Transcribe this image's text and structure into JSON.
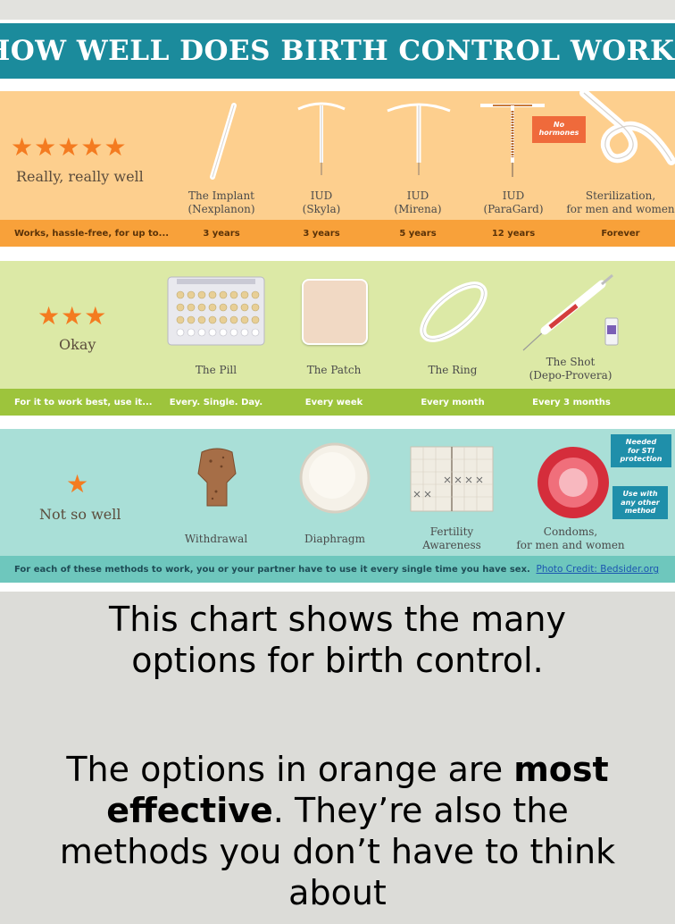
{
  "title": "HOW WELL DOES BIRTH CONTROL WORK?",
  "tiers": {
    "top": {
      "rating_label": "Really, really well",
      "star_count": 5,
      "items": [
        {
          "line1": "The Implant",
          "line2": "(Nexplanon)",
          "duration": "3 years"
        },
        {
          "line1": "IUD",
          "line2": "(Skyla)",
          "duration": "3 years"
        },
        {
          "line1": "IUD",
          "line2": "(Mirena)",
          "duration": "5 years"
        },
        {
          "line1": "IUD",
          "line2": "(ParaGard)",
          "duration": "12 years"
        },
        {
          "line1": "Sterilization,",
          "line2": "for men and women",
          "duration": "Forever"
        }
      ],
      "badge_line1": "No",
      "badge_line2": "hormones",
      "footer_lead": "Works, hassle-free, for up to..."
    },
    "middle": {
      "rating_label": "Okay",
      "star_count": 3,
      "items": [
        {
          "line1": "The Pill",
          "line2": "",
          "frequency": "Every. Single. Day."
        },
        {
          "line1": "The Patch",
          "line2": "",
          "frequency": "Every week"
        },
        {
          "line1": "The Ring",
          "line2": "",
          "frequency": "Every month"
        },
        {
          "line1": "The Shot",
          "line2": "(Depo-Provera)",
          "frequency": "Every 3 months"
        }
      ],
      "footer_lead": "For it to work best, use it..."
    },
    "bottom": {
      "rating_label": "Not so well",
      "star_count": 1,
      "items": [
        {
          "line1": "Withdrawal",
          "line2": ""
        },
        {
          "line1": "Diaphragm",
          "line2": ""
        },
        {
          "line1": "Fertility",
          "line2": "Awareness"
        },
        {
          "line1": "Condoms,",
          "line2": "for men and women"
        }
      ],
      "badge_sti": [
        "Needed",
        "for STI",
        "protection"
      ],
      "badge_other": [
        "Use with",
        "any other",
        "method"
      ],
      "footer_text": "For each of these methods to work, you or your partner have to use it every single time you have sex.",
      "credit": "Photo Credit: Bedsider.org"
    }
  },
  "caption1": {
    "line1": "This chart shows the many",
    "line2": "options for birth control."
  },
  "caption2": {
    "part1": "The options in orange are ",
    "bold": "most effective",
    "part2": ". They’re also the methods you don’t have to think about"
  },
  "colors": {
    "title_bar": "#1b8b9c",
    "top_tier": "#fdcf8e",
    "top_footer": "#f8a13a",
    "middle_tier": "#dce9a6",
    "middle_footer": "#9dc43c",
    "bottom_tier": "#a9dfd7",
    "bottom_footer": "#6ec7bd",
    "star": "#f47b20"
  }
}
